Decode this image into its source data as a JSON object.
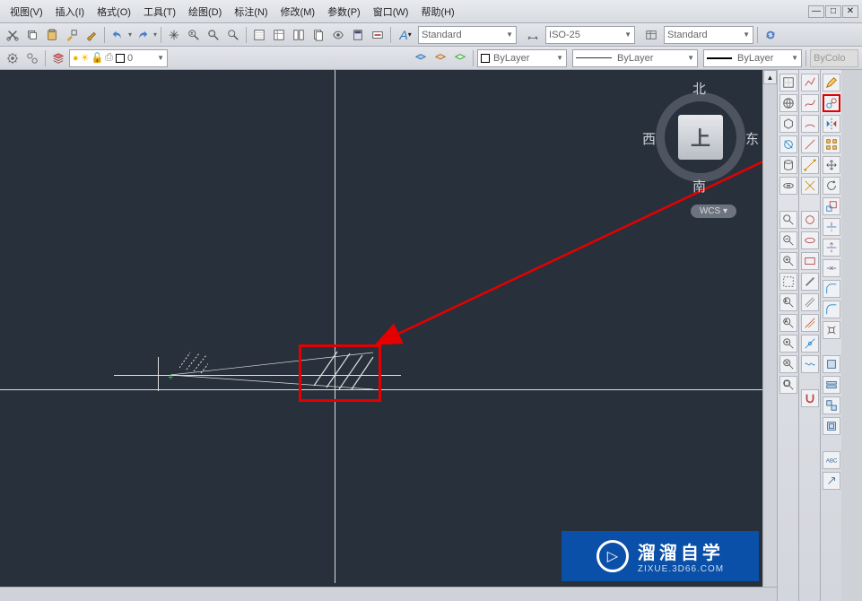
{
  "menu": {
    "items": [
      "视图(V)",
      "插入(I)",
      "格式(O)",
      "工具(T)",
      "绘图(D)",
      "标注(N)",
      "修改(M)",
      "参数(P)",
      "窗口(W)",
      "帮助(H)"
    ]
  },
  "toolbar1": {
    "std_style": "Standard",
    "dim_style": "ISO-25",
    "txt_style": "Standard"
  },
  "toolbar2": {
    "layer_name": "0",
    "lt_name1": "ByLayer",
    "lt_name2": "ByLayer",
    "lt_name3": "ByLayer",
    "lt_name4": "ByColo"
  },
  "viewcube": {
    "top": "上",
    "n": "北",
    "s": "南",
    "e": "东",
    "w": "西",
    "wcs": "WCS"
  },
  "watermark": {
    "brand": "溜溜自学",
    "url": "ZIXUE.3D66.COM",
    "play": "▷"
  }
}
